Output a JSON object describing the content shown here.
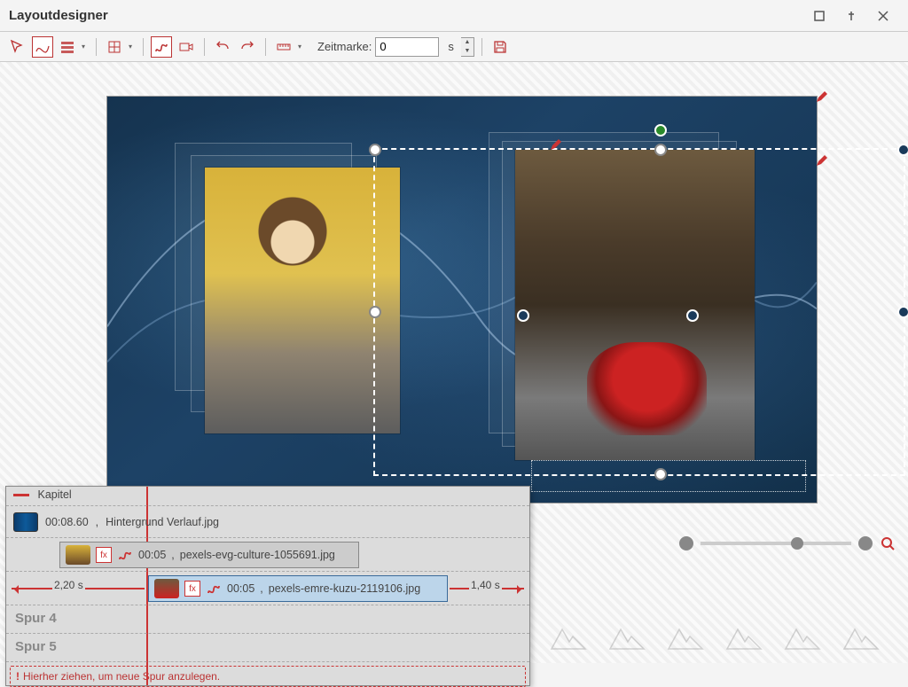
{
  "window": {
    "title": "Layoutdesigner"
  },
  "toolbar": {
    "zeitmarke_label": "Zeitmarke:",
    "zeitmarke_value": "0",
    "zeitmarke_unit": "s"
  },
  "zoom": {
    "value_pct": 60
  },
  "timeline": {
    "chapter_label": "Kapitel",
    "bg_clip": {
      "time": "00:08.60",
      "name": "Hintergrund Verlauf.jpg"
    },
    "clip1": {
      "time": "00:05",
      "name": "pexels-evg-culture-1055691.jpg"
    },
    "clip2": {
      "time": "00:05",
      "name": "pexels-emre-kuzu-2119106.jpg"
    },
    "left_gap": "2,20 s",
    "right_gap": "1,40 s",
    "track4": "Spur 4",
    "track5": "Spur 5",
    "drop_hint": "Hierher ziehen, um neue Spur anzulegen."
  },
  "colors": {
    "accent": "#b83333",
    "stage": "#1a3a5a",
    "selection": "#bcd5ea"
  }
}
